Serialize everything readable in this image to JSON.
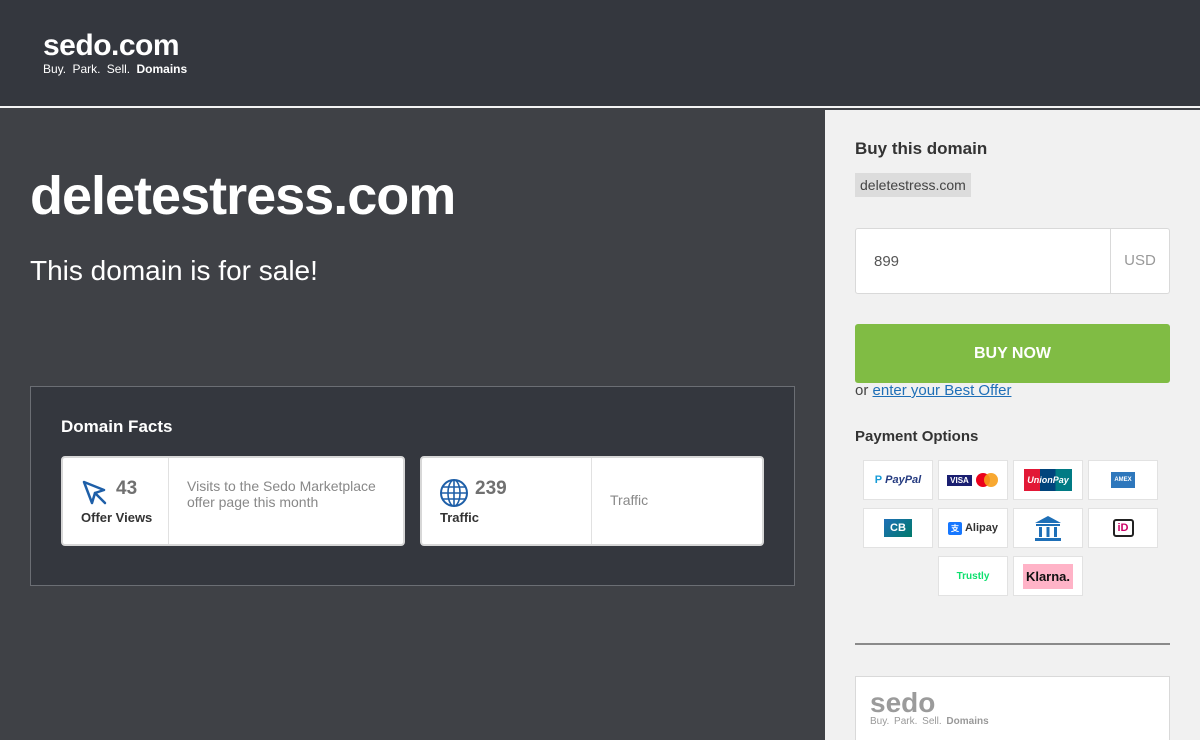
{
  "header": {
    "logo_main": "sedo.com",
    "logo_tag_plain": "Buy.  Park.  Sell.",
    "logo_tag_bold": "Domains"
  },
  "main": {
    "domain": "deletestress.com",
    "subtitle": "This domain is for sale!",
    "facts": {
      "title": "Domain Facts",
      "cards": [
        {
          "number": "43",
          "label": "Offer Views",
          "description": "Visits to the Sedo Marketplace offer page this month",
          "icon": "cursor-icon"
        },
        {
          "number": "239",
          "label": "Traffic",
          "description": "Traffic",
          "icon": "globe-icon"
        }
      ]
    }
  },
  "sidebar": {
    "title": "Buy this domain",
    "domain_chip": "deletestress.com",
    "price_value": "899",
    "currency": "USD",
    "buy_button": "BUY NOW",
    "offer_prefix": "or",
    "offer_link": "enter your Best Offer",
    "payment_title": "Payment Options",
    "payments": [
      {
        "name": "PayPal",
        "text": "PayPal",
        "color": "#253b80"
      },
      {
        "name": "Visa Mastercard",
        "text": "VISA",
        "color": "#1a1f71"
      },
      {
        "name": "UnionPay",
        "text": "UnionPay",
        "color": "#e21836"
      },
      {
        "name": "American Express",
        "text": "AMEX",
        "color": "#2e77bc"
      },
      {
        "name": "Cartes Bancaires",
        "text": "CB",
        "color": "#007a6a"
      },
      {
        "name": "Alipay",
        "text": "Alipay",
        "color": "#1677ff"
      },
      {
        "name": "Bank Transfer",
        "text": "",
        "color": "#1e6fb7"
      },
      {
        "name": "iDEAL",
        "text": "iD",
        "color": "#cc0066"
      },
      {
        "name": "Trustly",
        "text": "Trustly",
        "color": "#0ee06e"
      },
      {
        "name": "Klarna",
        "text": "Klarna.",
        "color": "#ffb3c7"
      }
    ],
    "footer_logo_main": "sedo",
    "footer_logo_tag_plain": "Buy. Park. Sell.",
    "footer_logo_tag_bold": "Domains"
  }
}
